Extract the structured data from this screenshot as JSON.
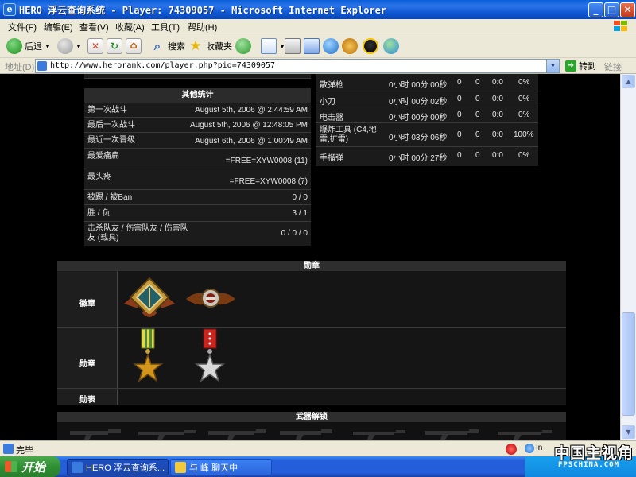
{
  "window": {
    "title": "HERO 浮云查询系统 - Player: 74309057 - Microsoft Internet Explorer",
    "app_icon": "ie-icon"
  },
  "menu": [
    "文件(F)",
    "编辑(E)",
    "查看(V)",
    "收藏(A)",
    "工具(T)",
    "帮助(H)"
  ],
  "toolbar": {
    "back_label": "后退",
    "search_label": "搜索",
    "favorites_label": "收藏夹"
  },
  "address": {
    "label": "地址(D)",
    "url": "http://www.herorank.com/player.php?pid=74309057",
    "go_label": "转到",
    "links_label": "链接"
  },
  "other_stats": {
    "title": "其他统计",
    "rows": [
      {
        "k": "第一次战斗",
        "v": "August 5th, 2006 @ 2:44:59 AM"
      },
      {
        "k": "最后一次战斗",
        "v": "August 5th, 2006 @ 12:48:05 PM"
      },
      {
        "k": "最近一次晋级",
        "v": "August 6th, 2006 @ 1:00:49 AM"
      },
      {
        "k": "最爱痛扁",
        "v": "=FREE=XYW0008 (11)"
      },
      {
        "k": "最头疼",
        "v": "=FREE=XYW0008 (7)"
      },
      {
        "k": "被踢 / 被Ban",
        "v": "0 / 0"
      },
      {
        "k": "胜 / 负",
        "v": "3 / 1"
      },
      {
        "k": "击杀队友 / 伤害队友 / 伤害队友 (载具)",
        "v": "0 / 0 / 0"
      }
    ]
  },
  "weapons": [
    {
      "name": "散弹枪",
      "time": "0小时 00分 00秒",
      "a": "0",
      "b": "0",
      "c": "0:0",
      "pct": "0%"
    },
    {
      "name": "小刀",
      "time": "0小时 00分 02秒",
      "a": "0",
      "b": "0",
      "c": "0:0",
      "pct": "0%"
    },
    {
      "name": "电击器",
      "time": "0小时 00分 00秒",
      "a": "0",
      "b": "0",
      "c": "0:0",
      "pct": "0%"
    },
    {
      "name": "爆炸工具 (C4,地雷,扩雷)",
      "time": "0小时 03分 06秒",
      "a": "0",
      "b": "0",
      "c": "0:0",
      "pct": "100%"
    },
    {
      "name": "手榴弹",
      "time": "0小时 00分 27秒",
      "a": "0",
      "b": "0",
      "c": "0:0",
      "pct": "0%"
    }
  ],
  "medals": {
    "title": "勋章",
    "badges_label": "徽章",
    "medals_label": "勋章",
    "ribbons_label": "勋表"
  },
  "unlock": {
    "title": "武器解锁"
  },
  "status": {
    "text": "完毕",
    "zone": "In"
  },
  "taskbar": {
    "start": "开始",
    "tasks": [
      "HERO 浮云查询系...",
      "与 峰 聊天中"
    ]
  },
  "watermark": {
    "main": "中国主视角",
    "sub": "FPSCHINA.COM"
  }
}
